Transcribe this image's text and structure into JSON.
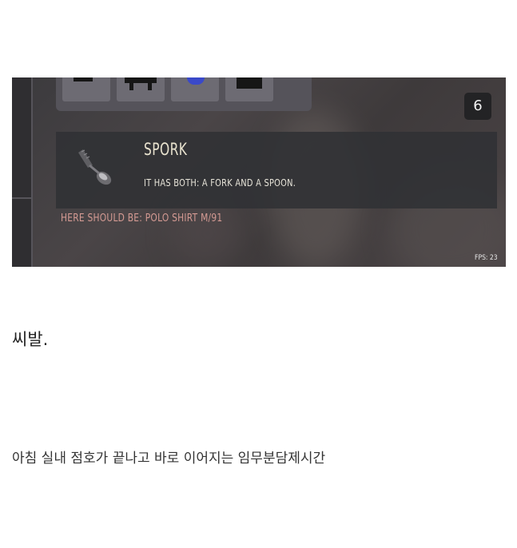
{
  "game": {
    "stack_count": "6",
    "item": {
      "icon": "spork-icon",
      "title": "SPORK",
      "description": "IT HAS BOTH: A FORK AND A SPOON."
    },
    "mismatch_note": "HERE SHOULD BE: POLO SHIRT M/91",
    "fps": "FPS: 23"
  },
  "post": {
    "comment": "씨발.",
    "caption": "아침 실내 점호가 끝나고 바로 이어지는 임무분담제시간"
  }
}
